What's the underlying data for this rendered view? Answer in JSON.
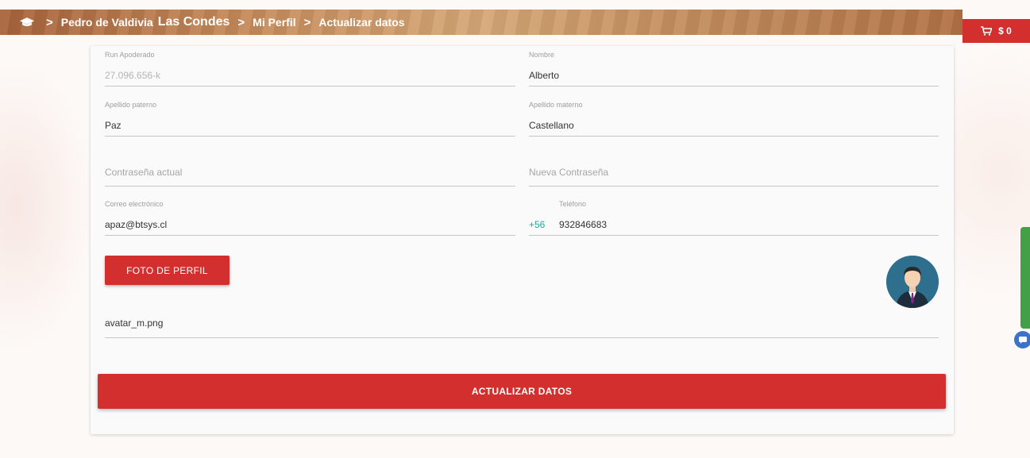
{
  "breadcrumb": {
    "items": [
      "Pedro de Valdivia",
      "Las Condes",
      "Mi Perfil",
      "Actualizar datos"
    ],
    "separator": ">"
  },
  "cart": {
    "amount": "$ 0"
  },
  "form": {
    "run": {
      "label": "Run Apoderado",
      "value": "27.096.656-k"
    },
    "nombre": {
      "label": "Nombre",
      "value": "Alberto"
    },
    "apellido_paterno": {
      "label": "Apellido paterno",
      "value": "Paz"
    },
    "apellido_materno": {
      "label": "Apellido materno",
      "value": "Castellano"
    },
    "password_actual": {
      "placeholder": "Contraseña actual"
    },
    "password_nueva": {
      "placeholder": "Nueva Contraseña"
    },
    "correo": {
      "label": "Correo electrónico",
      "value": "apaz@btsys.cl"
    },
    "telefono": {
      "label": "Teléfono",
      "prefix": "+56",
      "value": "932846683"
    },
    "foto_button": "FOTO DE PERFIL",
    "foto_file": "avatar_m.png",
    "submit_button": "ACTUALIZAR DATOS"
  },
  "colors": {
    "primary": "#d32f2f",
    "accent": "#26a69a",
    "chat": "#43a047"
  }
}
